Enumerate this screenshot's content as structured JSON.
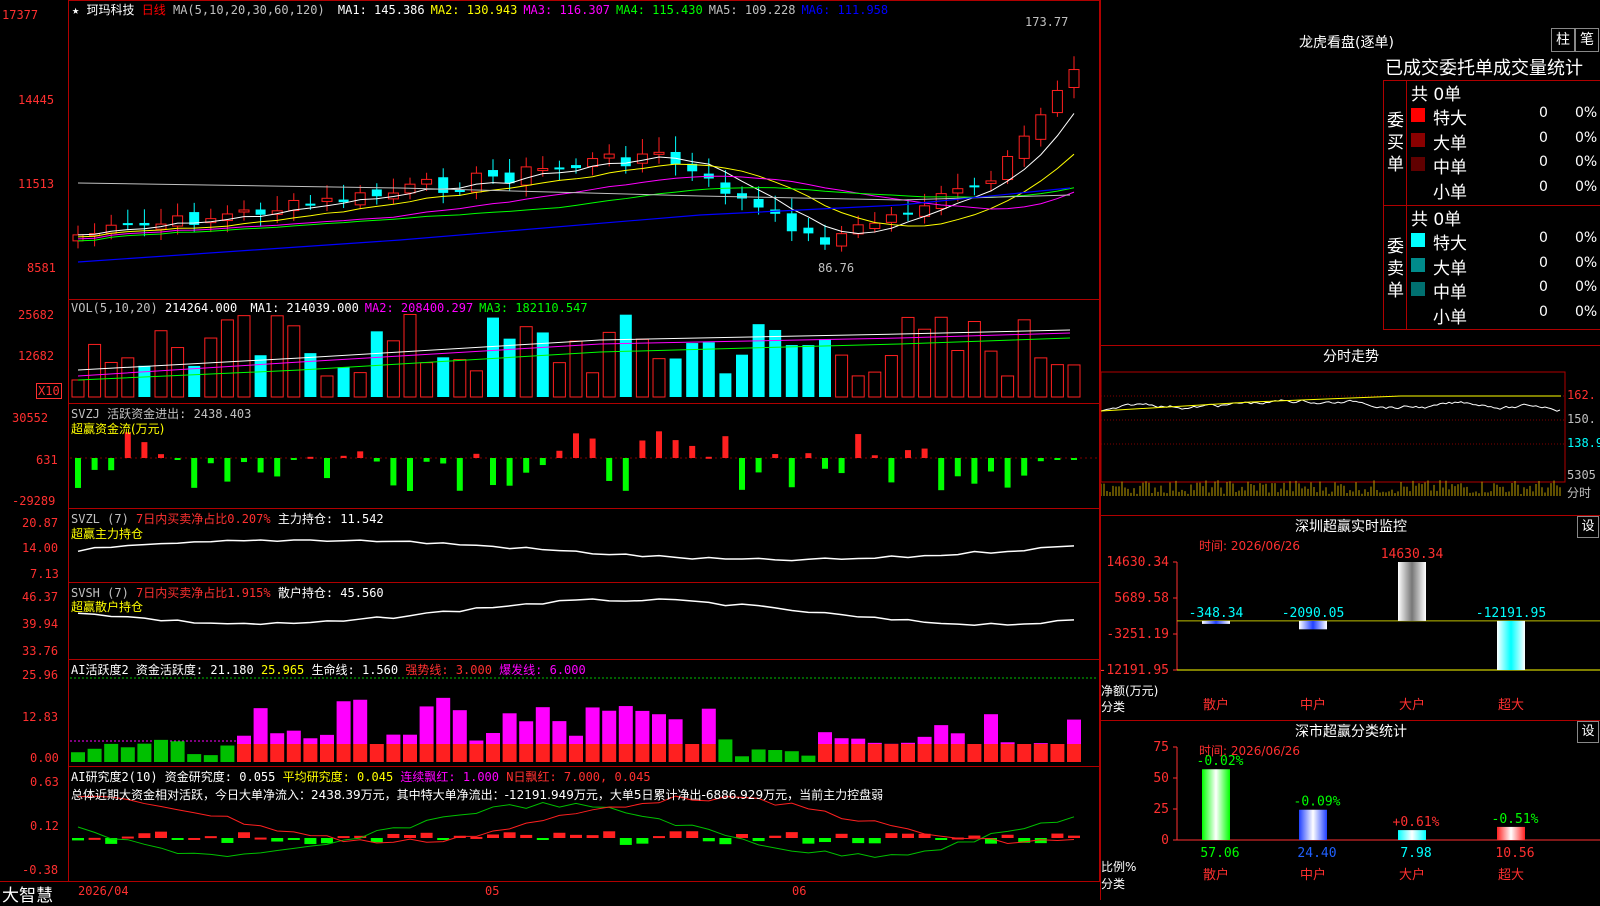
{
  "stock": {
    "name": "珂玛科技",
    "period": "日线",
    "ma_title": "MA(5,10,20,30,60,120)",
    "ma": [
      {
        "label": "MA1: 145.386",
        "color": "#ffffff"
      },
      {
        "label": "MA2: 130.943",
        "color": "#ffff00"
      },
      {
        "label": "MA3: 116.307",
        "color": "#ff00ff"
      },
      {
        "label": "MA4: 115.430",
        "color": "#00ff00"
      },
      {
        "label": "MA5: 109.228",
        "color": "#c0c0c0"
      },
      {
        "label": "MA6: 111.958",
        "color": "#0000ff"
      }
    ],
    "price_axis": [
      "17377",
      "14445",
      "11513",
      "8581"
    ],
    "high_mark": "173.77",
    "low_mark": "86.76",
    "logo": "大智慧",
    "date_start": "2026/04",
    "month_05": "05",
    "month_06": "06"
  },
  "vol": {
    "title": "VOL(5,10,20)",
    "value": "214264.000",
    "ma": [
      {
        "label": "MA1: 214039.000",
        "color": "#ffffff"
      },
      {
        "label": "MA2: 208400.297",
        "color": "#ff00ff"
      },
      {
        "label": "MA3: 182110.547",
        "color": "#00ff00"
      }
    ],
    "axis": [
      "25682",
      "12682"
    ],
    "unit": "X10"
  },
  "svzj": {
    "title": "SVZJ  活跃资金进出: 2438.403",
    "subtitle": "超赢资金流(万元)",
    "axis": [
      "30552",
      "631",
      "-29289"
    ]
  },
  "svzl": {
    "title": "SVZL (7)",
    "ratio": "7日内买卖净占比0.207%",
    "hold": "主力持仓: 11.542",
    "subtitle": "超赢主力持仓",
    "axis": [
      "20.87",
      "14.00",
      "7.13"
    ]
  },
  "svsh": {
    "title": "SVSH (7)",
    "ratio": "7日内买卖净占比1.915%",
    "hold": "散户持仓: 45.560",
    "subtitle": "超赢散户持仓",
    "axis": [
      "46.37",
      "39.94",
      "33.76"
    ]
  },
  "ai1": {
    "title": "AI活跃度2 资金活跃度: 21.180",
    "v2": "25.965",
    "life": "生命线: 1.560",
    "strong": "强势线: 3.000",
    "burst": "爆发线: 6.000",
    "axis": [
      "25.96",
      "12.83",
      "0.00"
    ]
  },
  "ai2": {
    "title": "AI研究度2(10) 资金研究度: 0.055",
    "avg": "平均研究度: 0.045",
    "cont": "连续飘红: 1.000",
    "nday": "N日飘红: 7.000, 0.045",
    "desc": "总体近期大资金相对活跃，今日大单净流入：2438.39万元，其中特大单净流出：-12191.949万元，大单5日累计净出-6886.929万元，当前主力控盘弱",
    "axis": [
      "0.63",
      "0.12",
      "-0.38"
    ]
  },
  "dragon": {
    "title": "龙虎看盘(逐单)",
    "btn1": "柱",
    "btn2": "笔",
    "header": "已成交委托单成交量统计",
    "buy_label": "委买单",
    "sell_label": "委卖单",
    "buy_total": "共 0单",
    "sell_total": "共 0单",
    "buy_rows": [
      {
        "name": "特大",
        "count": "0",
        "pct": "0%",
        "color": "#ff0000"
      },
      {
        "name": "大单",
        "count": "0",
        "pct": "0%",
        "color": "#8b0000"
      },
      {
        "name": "中单",
        "count": "0",
        "pct": "0%",
        "color": "#600000"
      },
      {
        "name": "小单",
        "count": "0",
        "pct": "0%",
        "color": "#000000"
      }
    ],
    "sell_rows": [
      {
        "name": "特大",
        "count": "0",
        "pct": "0%",
        "color": "#00ffff"
      },
      {
        "name": "大单",
        "count": "0",
        "pct": "0%",
        "color": "#008b8b"
      },
      {
        "name": "中单",
        "count": "0",
        "pct": "0%",
        "color": "#007070"
      },
      {
        "name": "小单",
        "count": "0",
        "pct": "0%",
        "color": "#000000"
      }
    ]
  },
  "intraday": {
    "title": "分时走势",
    "axis": [
      "162.",
      "150.",
      "138.9",
      "5305"
    ],
    "vol_label": "分时"
  },
  "monitor": {
    "title": "深圳超赢实时监控",
    "set": "设",
    "time": "时间: 2026/06/26",
    "axis": [
      "14630.34",
      "5689.58",
      "-3251.19",
      "-12191.95"
    ],
    "ylabel": "净额(万元)",
    "xlabel": "分类",
    "chart_data": {
      "type": "bar",
      "categories": [
        "散户",
        "中户",
        "大户",
        "超大"
      ],
      "values": [
        -348.34,
        -2090.05,
        14630.34,
        -12191.95
      ],
      "value_labels": [
        "-348.34",
        "-2090.05",
        "14630.34",
        "-12191.95"
      ],
      "ylim": [
        -12191.95,
        14630.34
      ],
      "ylabel": "净额(万元)",
      "xlabel": "分类"
    }
  },
  "classify": {
    "title": "深市超赢分类统计",
    "set": "设",
    "time": "时间: 2026/06/26",
    "axis": [
      "75",
      "50",
      "25",
      "0"
    ],
    "ylabel": "比例%",
    "xlabel": "分类",
    "chart_data": {
      "type": "bar",
      "categories": [
        "散户",
        "中户",
        "大户",
        "超大"
      ],
      "values": [
        57.06,
        24.4,
        7.98,
        10.56
      ],
      "value_labels": [
        "57.06",
        "24.40",
        "7.98",
        "10.56"
      ],
      "changes": [
        "-0.02%",
        "-0.09%",
        "+0.61%",
        "-0.51%"
      ],
      "ylim": [
        0,
        75
      ],
      "ylabel": "比例%",
      "xlabel": "分类"
    }
  }
}
